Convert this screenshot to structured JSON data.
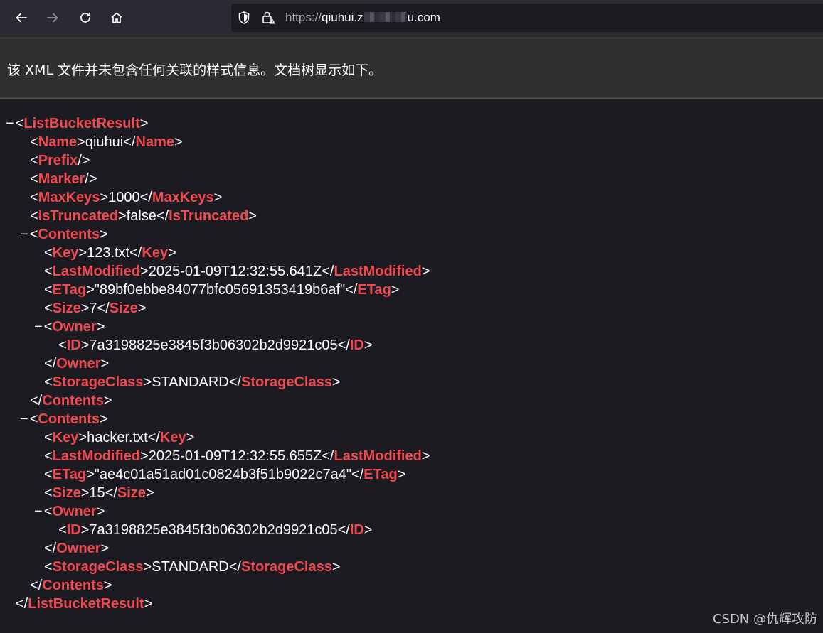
{
  "browser": {
    "url_scheme": "https://",
    "url_host_start": "qiuhui.z",
    "url_host_end": "u.com",
    "icons": [
      "back-arrow-icon",
      "forward-arrow-icon",
      "reload-icon",
      "home-icon",
      "shield-icon",
      "lock-warning-icon"
    ]
  },
  "banner": {
    "message": "该 XML 文件并未包含任何关联的样式信息。文档树显示如下。"
  },
  "xml": {
    "collapse_glyph": "−",
    "root": "ListBucketResult",
    "name": {
      "tag": "Name",
      "value": "qiuhui"
    },
    "prefix": {
      "tag": "Prefix"
    },
    "marker": {
      "tag": "Marker"
    },
    "maxkeys": {
      "tag": "MaxKeys",
      "value": "1000"
    },
    "istruncated": {
      "tag": "IsTruncated",
      "value": "false"
    },
    "contents": [
      {
        "tag": "Contents",
        "key": {
          "tag": "Key",
          "value": "123.txt"
        },
        "lastmodified": {
          "tag": "LastModified",
          "value": "2025-01-09T12:32:55.641Z"
        },
        "etag": {
          "tag": "ETag",
          "value": "\"89bf0ebbe84077bfc05691353419b6af\""
        },
        "size": {
          "tag": "Size",
          "value": "7"
        },
        "owner": {
          "tag": "Owner",
          "id_tag": "ID",
          "id_value": "7a3198825e3845f3b06302b2d9921c05"
        },
        "storageclass": {
          "tag": "StorageClass",
          "value": "STANDARD"
        }
      },
      {
        "tag": "Contents",
        "key": {
          "tag": "Key",
          "value": "hacker.txt"
        },
        "lastmodified": {
          "tag": "LastModified",
          "value": "2025-01-09T12:32:55.655Z"
        },
        "etag": {
          "tag": "ETag",
          "value": "\"ae4c01a51ad01c0824b3f51b9022c7a4\""
        },
        "size": {
          "tag": "Size",
          "value": "15"
        },
        "owner": {
          "tag": "Owner",
          "id_tag": "ID",
          "id_value": "7a3198825e3845f3b06302b2d9921c05"
        },
        "storageclass": {
          "tag": "StorageClass",
          "value": "STANDARD"
        }
      }
    ]
  },
  "watermark": "CSDN @仇辉攻防",
  "colors": {
    "tag": "#f0494f",
    "page_bg": "#1c1b22",
    "toolbar_bg": "#2b2a33",
    "banner_bg": "#2f2f2f"
  }
}
